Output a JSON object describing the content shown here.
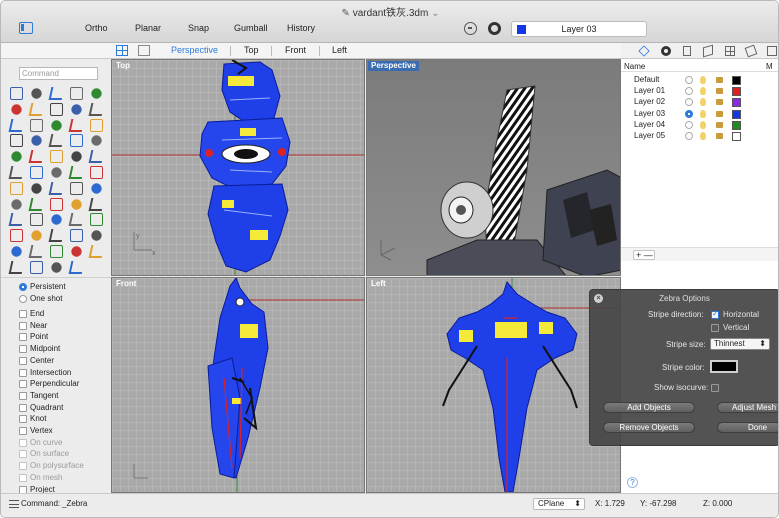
{
  "window": {
    "title": "vardant铁灰.3dm"
  },
  "toolbar": {
    "ortho": "Ortho",
    "planar": "Planar",
    "snap": "Snap",
    "gumball": "Gumball",
    "history": "History",
    "current_layer": "Layer 03",
    "current_layer_color": "#1437e6"
  },
  "view_tabs": [
    "Perspective",
    "Top",
    "Front",
    "Left"
  ],
  "command": {
    "placeholder": "Command",
    "prompt_label": "Command:",
    "current": "_Zebra"
  },
  "osnap": {
    "persistent": "Persistent",
    "one_shot": "One shot",
    "items": [
      {
        "label": "End",
        "enabled": true
      },
      {
        "label": "Near",
        "enabled": true
      },
      {
        "label": "Point",
        "enabled": true
      },
      {
        "label": "Midpoint",
        "enabled": true
      },
      {
        "label": "Center",
        "enabled": true
      },
      {
        "label": "Intersection",
        "enabled": true
      },
      {
        "label": "Perpendicular",
        "enabled": true
      },
      {
        "label": "Tangent",
        "enabled": true
      },
      {
        "label": "Quadrant",
        "enabled": true
      },
      {
        "label": "Knot",
        "enabled": true
      },
      {
        "label": "Vertex",
        "enabled": true
      },
      {
        "label": "On curve",
        "enabled": false
      },
      {
        "label": "On surface",
        "enabled": false
      },
      {
        "label": "On polysurface",
        "enabled": false
      },
      {
        "label": "On mesh",
        "enabled": false
      },
      {
        "label": "Project",
        "enabled": true
      }
    ]
  },
  "viewports": {
    "top": "Top",
    "perspective": "Perspective",
    "front": "Front",
    "left": "Left"
  },
  "layers": {
    "header_name": "Name",
    "header_m": "M",
    "rows": [
      {
        "name": "Default",
        "color": "#000000",
        "current": false
      },
      {
        "name": "Layer 01",
        "color": "#e02020",
        "current": false
      },
      {
        "name": "Layer 02",
        "color": "#8a2be2",
        "current": false
      },
      {
        "name": "Layer 03",
        "color": "#1437e6",
        "current": true
      },
      {
        "name": "Layer 04",
        "color": "#1e8c1e",
        "current": false
      },
      {
        "name": "Layer 05",
        "color": "#ffffff",
        "current": false
      }
    ],
    "add_label": "+ —"
  },
  "zebra": {
    "title": "Zebra Options",
    "stripe_direction_label": "Stripe direction:",
    "horizontal": "Horizontal",
    "vertical": "Vertical",
    "stripe_size_label": "Stripe size:",
    "stripe_size_value": "Thinnest",
    "stripe_color_label": "Stripe color:",
    "show_isocurve_label": "Show isocurve:",
    "add_objects": "Add Objects",
    "adjust_mesh": "Adjust Mesh",
    "remove_objects": "Remove Objects",
    "done": "Done"
  },
  "status": {
    "cplane": "CPlane",
    "x": "X: 1.729",
    "y": "Y: -67.298",
    "z": "Z: 0.000"
  }
}
